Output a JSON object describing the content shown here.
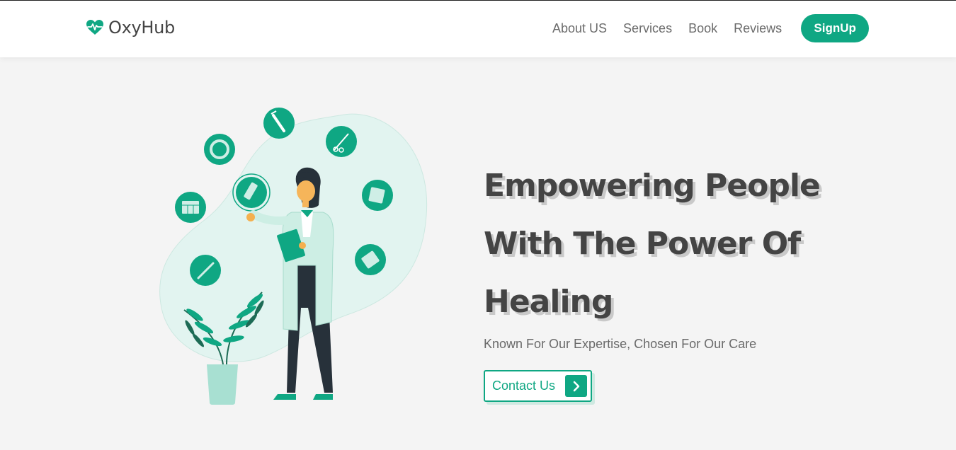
{
  "brand": {
    "name": "OxyHub",
    "accent": "#0fa783",
    "icon": "heart-pulse-icon"
  },
  "nav": {
    "items": [
      {
        "label": "About US"
      },
      {
        "label": "Services"
      },
      {
        "label": "Book"
      },
      {
        "label": "Reviews"
      }
    ],
    "signup_label": "SignUp"
  },
  "hero": {
    "title_line1": "Empowering People",
    "title_line2": "With The Power Of",
    "title_line3": "Healing",
    "subtitle": "Known For Our Expertise, Chosen For Our Care",
    "cta_label": "Contact Us",
    "cta_icon": "chevron-right-icon"
  },
  "illustration": {
    "subject": "doctor-with-clipboard",
    "icons": [
      "syringe-icon",
      "scissors-icon",
      "ring-icon",
      "pill-bottle-icon",
      "calendar-icon",
      "notepad-icon",
      "thermometer-icon",
      "pill-pack-icon",
      "plant-icon"
    ]
  }
}
